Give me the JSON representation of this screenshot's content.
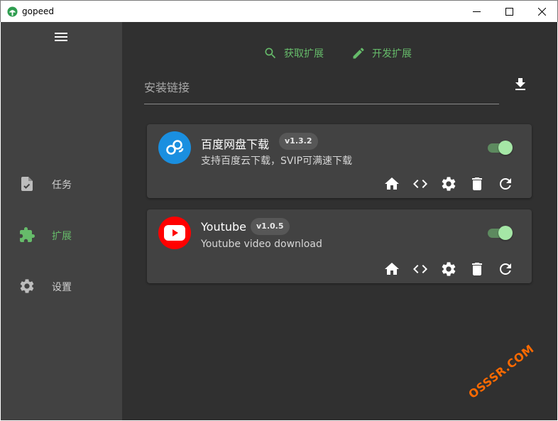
{
  "window": {
    "title": "gopeed"
  },
  "sidebar": {
    "items": [
      {
        "label": "任务",
        "icon": "task-icon",
        "active": false
      },
      {
        "label": "扩展",
        "icon": "puzzle-icon",
        "active": true
      },
      {
        "label": "设置",
        "icon": "gear-icon",
        "active": false
      }
    ]
  },
  "main": {
    "get_extensions_label": "获取扩展",
    "develop_extensions_label": "开发扩展",
    "install_placeholder": "安装链接"
  },
  "extensions": [
    {
      "name": "百度网盘下载",
      "version": "v1.3.2",
      "description": "支持百度云下载，SVIP可满速下载",
      "enabled": true,
      "logo_color": "#2196f3"
    },
    {
      "name": "Youtube",
      "version": "v1.0.5",
      "description": "Youtube video download",
      "enabled": true,
      "logo_color": "#ff0000"
    }
  ],
  "colors": {
    "accent": "#66bb6a",
    "sidebar_bg": "#424242",
    "main_bg": "#303030",
    "card_bg": "#424242"
  },
  "watermark": "OSSSR.COM"
}
